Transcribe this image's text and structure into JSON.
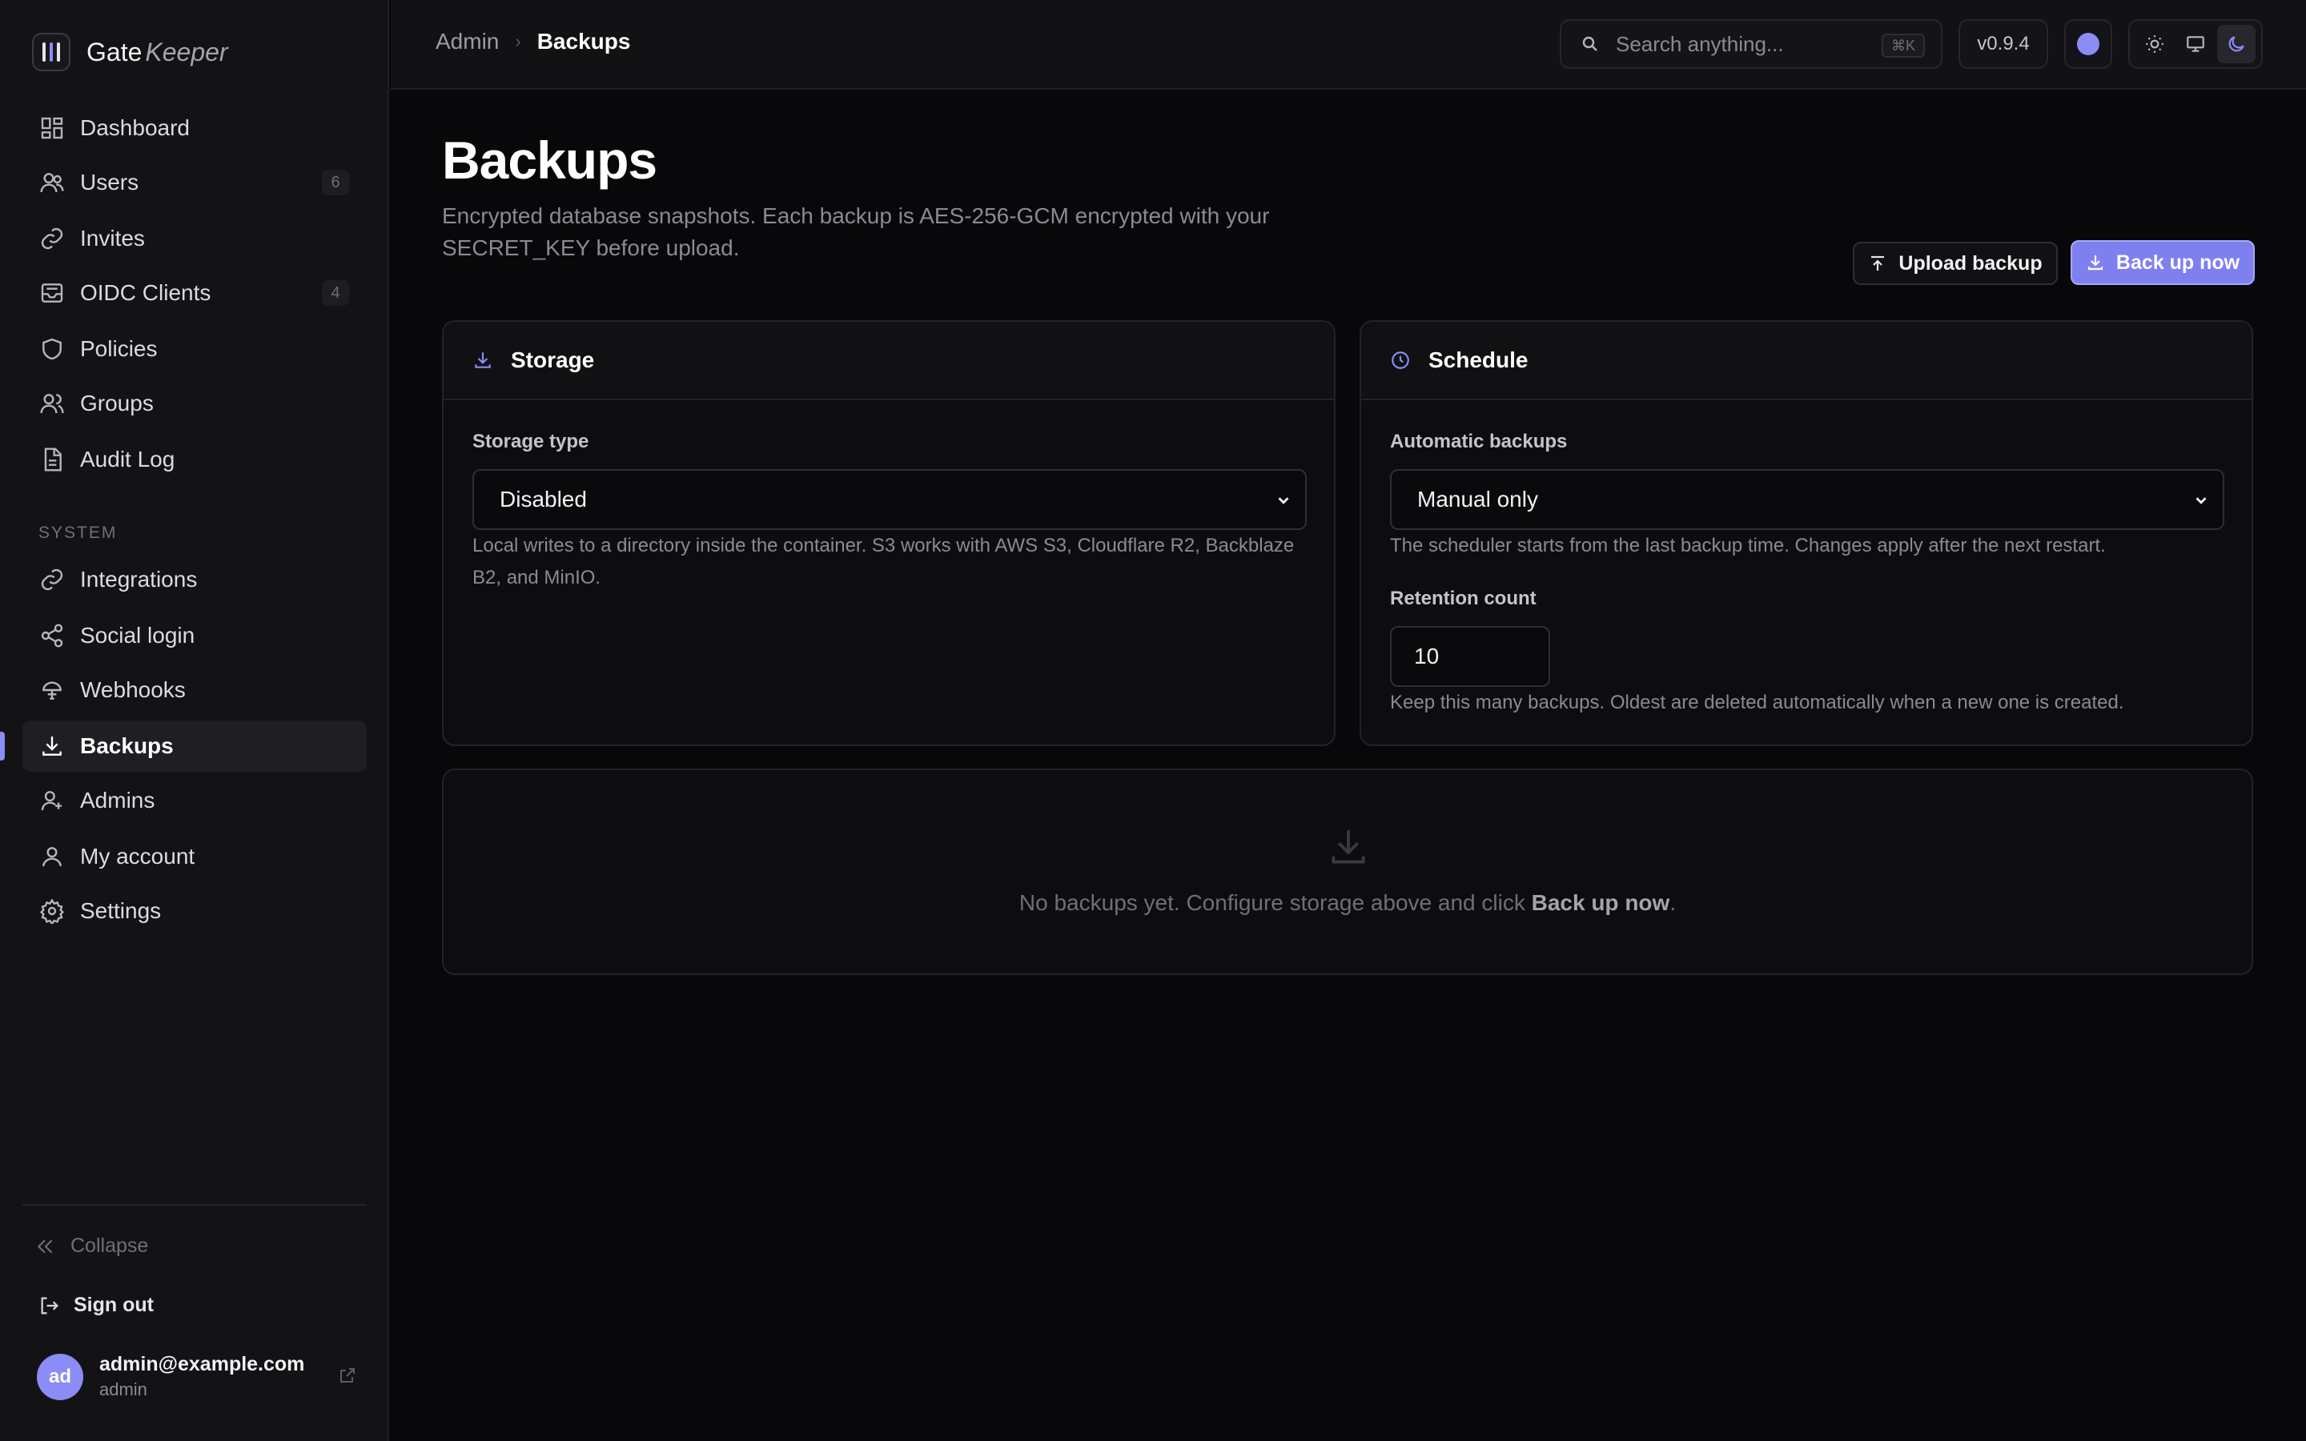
{
  "brand": {
    "name_primary": "Gate",
    "name_secondary": "Keeper"
  },
  "sidebar": {
    "items": [
      {
        "label": "Dashboard",
        "icon": "grid-icon",
        "count": ""
      },
      {
        "label": "Users",
        "icon": "users-icon",
        "count": "6"
      },
      {
        "label": "Invites",
        "icon": "link-icon",
        "count": ""
      },
      {
        "label": "OIDC Clients",
        "icon": "inbox-icon",
        "count": "4"
      },
      {
        "label": "Policies",
        "icon": "shield-icon",
        "count": ""
      },
      {
        "label": "Groups",
        "icon": "group-icon",
        "count": ""
      },
      {
        "label": "Audit Log",
        "icon": "document-icon",
        "count": ""
      }
    ],
    "section_label": "SYSTEM",
    "system_items": [
      {
        "label": "Integrations",
        "icon": "link-icon"
      },
      {
        "label": "Social login",
        "icon": "share-icon"
      },
      {
        "label": "Webhooks",
        "icon": "webhook-icon"
      },
      {
        "label": "Backups",
        "icon": "download-icon",
        "active": true
      },
      {
        "label": "Admins",
        "icon": "user-plus-icon"
      },
      {
        "label": "My account",
        "icon": "user-icon"
      },
      {
        "label": "Settings",
        "icon": "gear-icon"
      }
    ],
    "collapse_label": "Collapse",
    "signout_label": "Sign out",
    "user": {
      "initials": "ad",
      "email": "admin@example.com",
      "role": "admin"
    }
  },
  "topbar": {
    "breadcrumb": {
      "root": "Admin",
      "current": "Backups"
    },
    "search_placeholder": "Search anything...",
    "search_shortcut": "⌘K",
    "version": "v0.9.4",
    "accent_color": "#8b8cf5"
  },
  "page": {
    "title": "Backups",
    "description": "Encrypted database snapshots. Each backup is AES-256-GCM encrypted with your SECRET_KEY before upload.",
    "upload_button": "Upload backup",
    "backup_button": "Back up now"
  },
  "storage_card": {
    "title": "Storage",
    "field_label": "Storage type",
    "selected": "Disabled",
    "help": "Local writes to a directory inside the container. S3 works with AWS S3, Cloudflare R2, Backblaze B2, and MinIO."
  },
  "schedule_card": {
    "title": "Schedule",
    "auto_label": "Automatic backups",
    "auto_selected": "Manual only",
    "auto_help": "The scheduler starts from the last backup time. Changes apply after the next restart.",
    "retention_label": "Retention count",
    "retention_value": "10",
    "retention_help": "Keep this many backups. Oldest are deleted automatically when a new one is created."
  },
  "empty_state": {
    "text_before": "No backups yet. Configure storage above and click ",
    "text_bold": "Back up now",
    "text_after": "."
  }
}
